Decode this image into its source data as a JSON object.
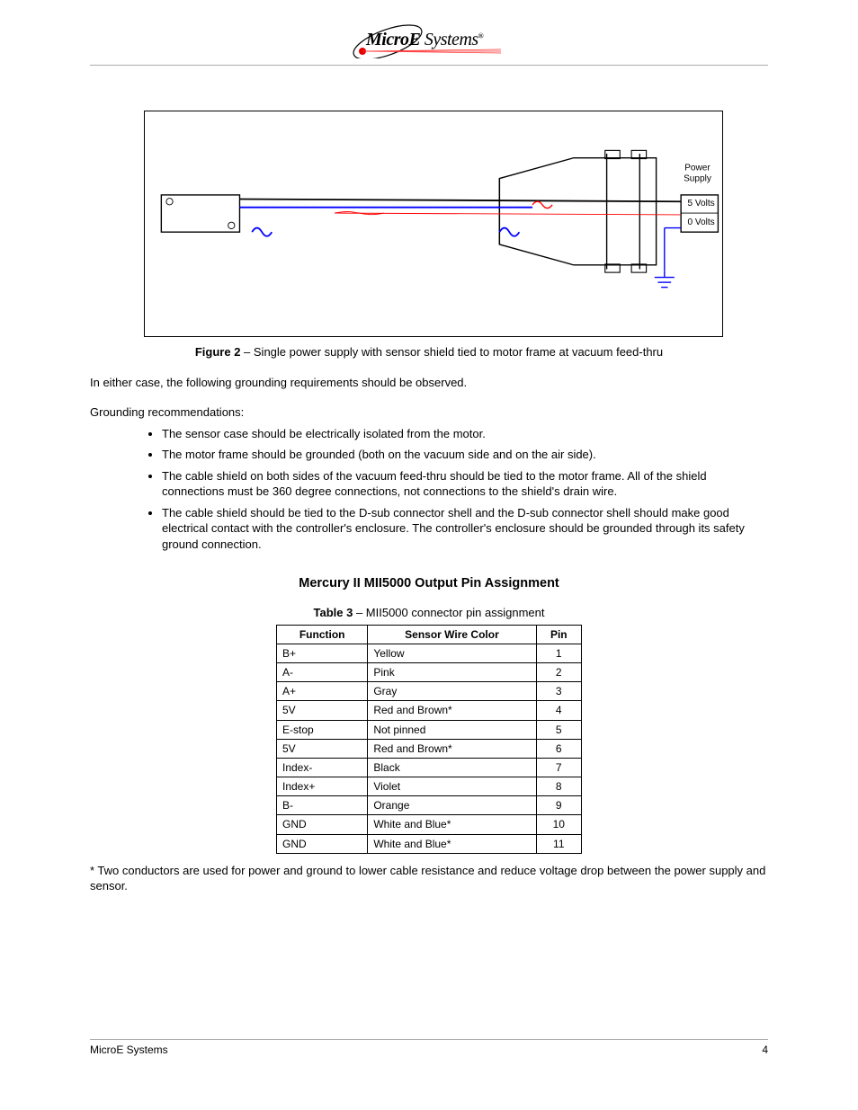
{
  "header": {
    "brand_bold": "MicroE",
    "brand_light": " Systems",
    "brand_reg": "®"
  },
  "figure": {
    "power_supply_label": "Power\nSupply",
    "v5_label": "5 Volts",
    "v0_label": "0 Volts",
    "caption_bold": "Figure 2",
    "caption_rest": " – Single power supply with sensor shield tied to motor frame at vacuum feed‑thru"
  },
  "body": {
    "para1": "In either case, the following grounding requirements should be observed.",
    "recommend_label": "Grounding recommendations:",
    "bullets": [
      "The sensor case should be electrically isolated from the motor.",
      "The motor frame should be grounded (both on the vacuum side and on the air side).",
      "The cable shield on both sides of the vacuum feed‑thru should be tied to the motor frame. All of the shield connections must be 360 degree connections, not connections to the shield's drain wire.",
      "The cable shield should be tied to the D‑sub connector shell and the D‑sub connector shell should make good electrical contact with the controller's enclosure. The controller's enclosure should be grounded through its safety ground connection."
    ]
  },
  "pinout": {
    "title": "Mercury II MII5000 Output Pin Assignment",
    "caption_bold": "Table 3",
    "caption_rest": " – MII5000 connector pin assignment",
    "headers": [
      "Function",
      "Sensor Wire Color",
      "Pin"
    ],
    "rows": [
      {
        "func": "B+",
        "color": "Yellow",
        "pin": "1"
      },
      {
        "func": "A‑",
        "color": "Pink",
        "pin": "2"
      },
      {
        "func": "A+",
        "color": "Gray",
        "pin": "3"
      },
      {
        "func": "5V",
        "color": "Red and Brown*",
        "pin": "4"
      },
      {
        "func": "E‑stop",
        "color": "Not pinned",
        "pin": "5"
      },
      {
        "func": "5V",
        "color": "Red and Brown*",
        "pin": "6"
      },
      {
        "func": "Index‑",
        "color": "Black",
        "pin": "7"
      },
      {
        "func": "Index+",
        "color": "Violet",
        "pin": "8"
      },
      {
        "func": "B‑",
        "color": "Orange",
        "pin": "9"
      },
      {
        "func": "GND",
        "color": "White and Blue*",
        "pin": "10"
      },
      {
        "func": "GND",
        "color": "White and Blue*",
        "pin": "11"
      }
    ],
    "footnote": "* Two conductors are used for power and ground to lower cable resistance and reduce voltage drop between the power supply and sensor."
  },
  "footer": {
    "left": "MicroE Systems",
    "right": "4"
  }
}
